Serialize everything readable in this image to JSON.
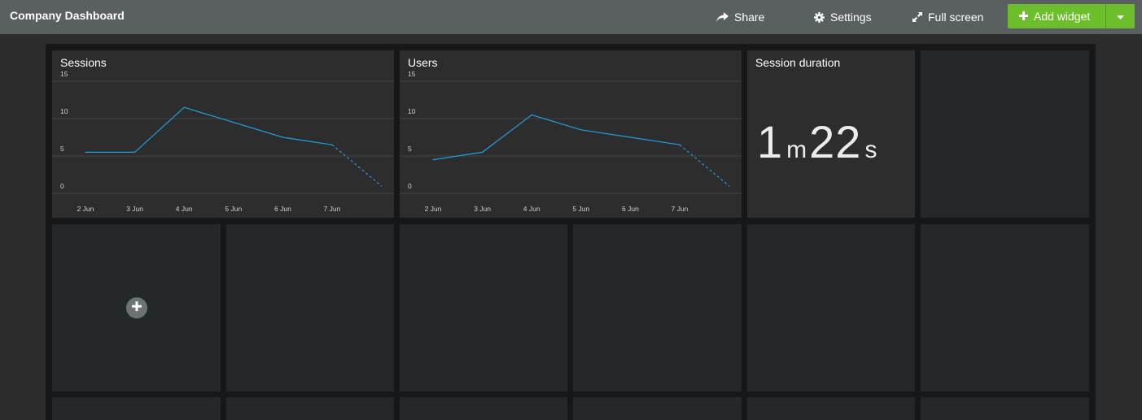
{
  "header": {
    "title": "Company Dashboard",
    "share_label": "Share",
    "settings_label": "Settings",
    "fullscreen_label": "Full screen",
    "add_widget_label": "Add widget"
  },
  "colors": {
    "topbar": "#5a5f61",
    "accent_green": "#6cbf2a",
    "line": "#1f9ee0",
    "widget_bg": "#2d2d2d",
    "empty_cell": "#25282a",
    "canvas": "#151718"
  },
  "icons": {
    "share": "share-arrow-icon",
    "settings": "gear-icon",
    "fullscreen": "expand-arrows-icon",
    "add": "plus-icon",
    "dropdown": "caret-down-icon",
    "add_cell": "plus-circle-icon"
  },
  "widgets": {
    "sessions": {
      "title": "Sessions"
    },
    "users": {
      "title": "Users"
    },
    "duration": {
      "title": "Session duration",
      "minutes": "1",
      "minutes_unit": "m",
      "seconds": "22",
      "seconds_unit": "s"
    }
  },
  "chart_data": [
    {
      "type": "line",
      "title": "Sessions",
      "categories": [
        "2 Jun",
        "3 Jun",
        "4 Jun",
        "5 Jun",
        "6 Jun",
        "7 Jun",
        ""
      ],
      "yticks": [
        0,
        5,
        10,
        15
      ],
      "ylim": [
        0,
        15
      ],
      "values": [
        5.5,
        5.5,
        11.5,
        9.5,
        7.5,
        6.5,
        1
      ],
      "last_segment_dashed": true,
      "grid": true
    },
    {
      "type": "line",
      "title": "Users",
      "categories": [
        "2 Jun",
        "3 Jun",
        "4 Jun",
        "5 Jun",
        "6 Jun",
        "7 Jun",
        ""
      ],
      "yticks": [
        0,
        5,
        10,
        15
      ],
      "ylim": [
        0,
        15
      ],
      "values": [
        4.5,
        5.5,
        10.5,
        8.5,
        7.5,
        6.5,
        1
      ],
      "last_segment_dashed": true,
      "grid": true
    }
  ]
}
